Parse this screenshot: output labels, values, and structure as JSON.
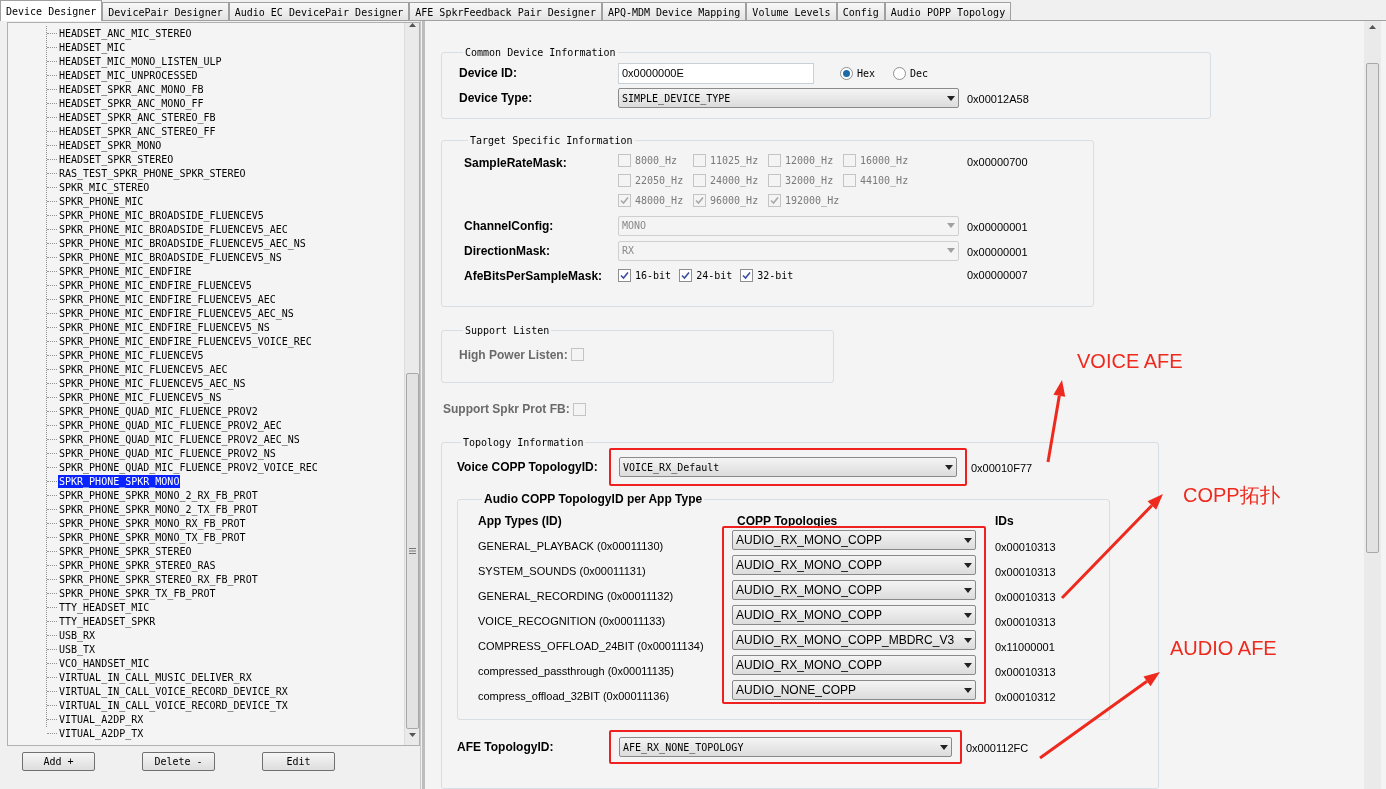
{
  "tabs": [
    {
      "label": "Device Designer",
      "selected": true
    },
    {
      "label": "DevicePair Designer",
      "selected": false
    },
    {
      "label": "Audio EC DevicePair Designer",
      "selected": false
    },
    {
      "label": "AFE SpkrFeedback Pair Designer",
      "selected": false
    },
    {
      "label": "APQ-MDM Device Mapping",
      "selected": false
    },
    {
      "label": "Volume Levels",
      "selected": false
    },
    {
      "label": "Config",
      "selected": false
    },
    {
      "label": "Audio POPP Topology",
      "selected": false
    }
  ],
  "device_tree": {
    "items": [
      {
        "label": "HEADSET_ANC_MIC_STEREO",
        "selected": false
      },
      {
        "label": "HEADSET_MIC",
        "selected": false
      },
      {
        "label": "HEADSET_MIC_MONO_LISTEN_ULP",
        "selected": false
      },
      {
        "label": "HEADSET_MIC_UNPROCESSED",
        "selected": false
      },
      {
        "label": "HEADSET_SPKR_ANC_MONO_FB",
        "selected": false
      },
      {
        "label": "HEADSET_SPKR_ANC_MONO_FF",
        "selected": false
      },
      {
        "label": "HEADSET_SPKR_ANC_STEREO_FB",
        "selected": false
      },
      {
        "label": "HEADSET_SPKR_ANC_STEREO_FF",
        "selected": false
      },
      {
        "label": "HEADSET_SPKR_MONO",
        "selected": false
      },
      {
        "label": "HEADSET_SPKR_STEREO",
        "selected": false
      },
      {
        "label": "RAS_TEST_SPKR_PHONE_SPKR_STEREO",
        "selected": false
      },
      {
        "label": "SPKR_MIC_STEREO",
        "selected": false
      },
      {
        "label": "SPKR_PHONE_MIC",
        "selected": false
      },
      {
        "label": "SPKR_PHONE_MIC_BROADSIDE_FLUENCEV5",
        "selected": false
      },
      {
        "label": "SPKR_PHONE_MIC_BROADSIDE_FLUENCEV5_AEC",
        "selected": false
      },
      {
        "label": "SPKR_PHONE_MIC_BROADSIDE_FLUENCEV5_AEC_NS",
        "selected": false
      },
      {
        "label": "SPKR_PHONE_MIC_BROADSIDE_FLUENCEV5_NS",
        "selected": false
      },
      {
        "label": "SPKR_PHONE_MIC_ENDFIRE",
        "selected": false
      },
      {
        "label": "SPKR_PHONE_MIC_ENDFIRE_FLUENCEV5",
        "selected": false
      },
      {
        "label": "SPKR_PHONE_MIC_ENDFIRE_FLUENCEV5_AEC",
        "selected": false
      },
      {
        "label": "SPKR_PHONE_MIC_ENDFIRE_FLUENCEV5_AEC_NS",
        "selected": false
      },
      {
        "label": "SPKR_PHONE_MIC_ENDFIRE_FLUENCEV5_NS",
        "selected": false
      },
      {
        "label": "SPKR_PHONE_MIC_ENDFIRE_FLUENCEV5_VOICE_REC",
        "selected": false
      },
      {
        "label": "SPKR_PHONE_MIC_FLUENCEV5",
        "selected": false
      },
      {
        "label": "SPKR_PHONE_MIC_FLUENCEV5_AEC",
        "selected": false
      },
      {
        "label": "SPKR_PHONE_MIC_FLUENCEV5_AEC_NS",
        "selected": false
      },
      {
        "label": "SPKR_PHONE_MIC_FLUENCEV5_NS",
        "selected": false
      },
      {
        "label": "SPKR_PHONE_QUAD_MIC_FLUENCE_PROV2",
        "selected": false
      },
      {
        "label": "SPKR_PHONE_QUAD_MIC_FLUENCE_PROV2_AEC",
        "selected": false
      },
      {
        "label": "SPKR_PHONE_QUAD_MIC_FLUENCE_PROV2_AEC_NS",
        "selected": false
      },
      {
        "label": "SPKR_PHONE_QUAD_MIC_FLUENCE_PROV2_NS",
        "selected": false
      },
      {
        "label": "SPKR_PHONE_QUAD_MIC_FLUENCE_PROV2_VOICE_REC",
        "selected": false
      },
      {
        "label": "SPKR_PHONE_SPKR_MONO",
        "selected": true
      },
      {
        "label": "SPKR_PHONE_SPKR_MONO_2_RX_FB_PROT",
        "selected": false
      },
      {
        "label": "SPKR_PHONE_SPKR_MONO_2_TX_FB_PROT",
        "selected": false
      },
      {
        "label": "SPKR_PHONE_SPKR_MONO_RX_FB_PROT",
        "selected": false
      },
      {
        "label": "SPKR_PHONE_SPKR_MONO_TX_FB_PROT",
        "selected": false
      },
      {
        "label": "SPKR_PHONE_SPKR_STEREO",
        "selected": false
      },
      {
        "label": "SPKR_PHONE_SPKR_STEREO_RAS",
        "selected": false
      },
      {
        "label": "SPKR_PHONE_SPKR_STEREO_RX_FB_PROT",
        "selected": false
      },
      {
        "label": "SPKR_PHONE_SPKR_TX_FB_PROT",
        "selected": false
      },
      {
        "label": "TTY_HEADSET_MIC",
        "selected": false
      },
      {
        "label": "TTY_HEADSET_SPKR",
        "selected": false
      },
      {
        "label": "USB_RX",
        "selected": false
      },
      {
        "label": "USB_TX",
        "selected": false
      },
      {
        "label": "VCO_HANDSET_MIC",
        "selected": false
      },
      {
        "label": "VIRTUAL_IN_CALL_MUSIC_DELIVER_RX",
        "selected": false
      },
      {
        "label": "VIRTUAL_IN_CALL_VOICE_RECORD_DEVICE_RX",
        "selected": false
      },
      {
        "label": "VIRTUAL_IN_CALL_VOICE_RECORD_DEVICE_TX",
        "selected": false
      },
      {
        "label": "VITUAL_A2DP_RX",
        "selected": false
      },
      {
        "label": "VITUAL_A2DP_TX",
        "selected": false
      }
    ]
  },
  "buttons": [
    "Add +",
    "Delete -",
    "Edit"
  ],
  "common_device_information": {
    "title": "Common Device Information",
    "device_id": {
      "label": "Device ID:",
      "value": "0x0000000E"
    },
    "id_format": [
      {
        "label": "Hex",
        "selected": true
      },
      {
        "label": "Dec",
        "selected": false
      }
    ],
    "device_type": {
      "label": "Device Type:",
      "value": "SIMPLE_DEVICE_TYPE",
      "id": "0x00012A58"
    }
  },
  "target_specific_information": {
    "title": "Target Specific Information",
    "sample_rate_mask": {
      "label": "SampleRateMask:",
      "id": "0x00000700",
      "options": [
        {
          "label": "8000_Hz",
          "checked": false,
          "disabled": true
        },
        {
          "label": "11025_Hz",
          "checked": false,
          "disabled": true
        },
        {
          "label": "12000_Hz",
          "checked": false,
          "disabled": true
        },
        {
          "label": "16000_Hz",
          "checked": false,
          "disabled": true
        },
        {
          "label": "22050_Hz",
          "checked": false,
          "disabled": true
        },
        {
          "label": "24000_Hz",
          "checked": false,
          "disabled": true
        },
        {
          "label": "32000_Hz",
          "checked": false,
          "disabled": true
        },
        {
          "label": "44100_Hz",
          "checked": false,
          "disabled": true
        },
        {
          "label": "48000_Hz",
          "checked": true,
          "disabled": true
        },
        {
          "label": "96000_Hz",
          "checked": true,
          "disabled": true
        },
        {
          "label": "192000_Hz",
          "checked": true,
          "disabled": true
        }
      ]
    },
    "channel_config": {
      "label": "ChannelConfig:",
      "value": "MONO",
      "disabled": true,
      "id": "0x00000001"
    },
    "direction_mask": {
      "label": "DirectionMask:",
      "value": "RX",
      "disabled": true,
      "id": "0x00000001"
    },
    "afe_bits_per_sample_mask": {
      "label": "AfeBitsPerSampleMask:",
      "id": "0x00000007",
      "options": [
        {
          "label": "16-bit",
          "checked": true,
          "disabled": false
        },
        {
          "label": "24-bit",
          "checked": true,
          "disabled": false
        },
        {
          "label": "32-bit",
          "checked": true,
          "disabled": false
        }
      ]
    }
  },
  "support_listen": {
    "title": "Support Listen",
    "high_power_listen": {
      "label": "High Power Listen:",
      "checked": false,
      "disabled": true
    }
  },
  "support_spkr_prot_fb": {
    "label": "Support Spkr Prot FB:",
    "checked": false,
    "disabled": true
  },
  "topology_information": {
    "title": "Topology Information",
    "voice_copp": {
      "label": "Voice COPP TopologyID:",
      "value": "VOICE_RX_Default",
      "id": "0x00010F77"
    },
    "audio_copp": {
      "title": "Audio COPP TopologyID per App Type",
      "columns": [
        "App Types (ID)",
        "COPP Topologies",
        "IDs"
      ],
      "rows": [
        {
          "app_type": "GENERAL_PLAYBACK (0x00011130)",
          "topology": "AUDIO_RX_MONO_COPP",
          "id": "0x00010313"
        },
        {
          "app_type": "SYSTEM_SOUNDS (0x00011131)",
          "topology": "AUDIO_RX_MONO_COPP",
          "id": "0x00010313"
        },
        {
          "app_type": "GENERAL_RECORDING (0x00011132)",
          "topology": "AUDIO_RX_MONO_COPP",
          "id": "0x00010313"
        },
        {
          "app_type": "VOICE_RECOGNITION (0x00011133)",
          "topology": "AUDIO_RX_MONO_COPP",
          "id": "0x00010313"
        },
        {
          "app_type": "COMPRESS_OFFLOAD_24BIT (0x00011134)",
          "topology": "AUDIO_RX_MONO_COPP_MBDRC_V3",
          "id": "0x11000001"
        },
        {
          "app_type": "compressed_passthrough (0x00011135)",
          "topology": "AUDIO_RX_MONO_COPP",
          "id": "0x00010313"
        },
        {
          "app_type": "compress_offload_32BIT (0x00011136)",
          "topology": "AUDIO_NONE_COPP",
          "id": "0x00010312"
        }
      ]
    },
    "afe_topology": {
      "label": "AFE TopologyID:",
      "value": "AFE_RX_NONE_TOPOLOGY",
      "id": "0x000112FC"
    }
  },
  "annotations": [
    {
      "label": "VOICE AFE"
    },
    {
      "label": "COPP拓扑"
    },
    {
      "label": "AUDIO AFE"
    }
  ]
}
